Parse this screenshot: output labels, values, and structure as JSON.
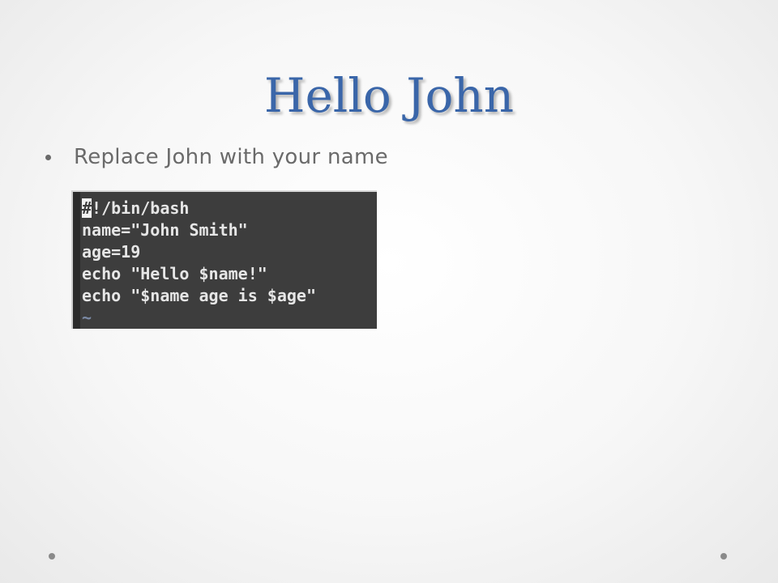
{
  "slide": {
    "title": "Hello John",
    "bullets": [
      "Replace John with your name"
    ]
  },
  "terminal": {
    "cursor_char": "#",
    "line1_rest": "!/bin/bash",
    "lines": [
      "name=\"John Smith\"",
      "age=19",
      "echo \"Hello $name!\"",
      "echo \"$name age is $age\""
    ],
    "empty_line_marker": "~"
  },
  "colors": {
    "title": "#3a66a9",
    "body_text": "#6a6a6a",
    "terminal_bg": "#3d3d3d",
    "terminal_text": "#e6e6e6"
  }
}
